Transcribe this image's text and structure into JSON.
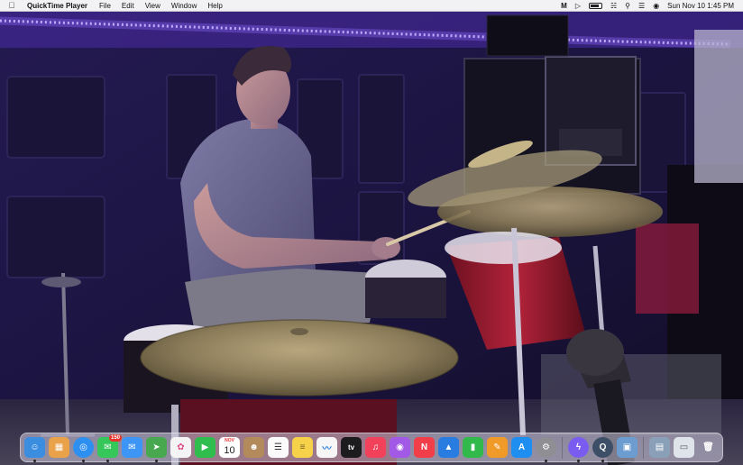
{
  "menubar": {
    "app_name": "QuickTime Player",
    "menus": [
      "File",
      "Edit",
      "View",
      "Window",
      "Help"
    ],
    "clock": "Sun Nov 10  1:45 PM",
    "status_icons": [
      "malwarebytes-icon",
      "play-icon",
      "battery-icon",
      "wifi-icon",
      "search-icon",
      "control-center-icon",
      "siri-icon"
    ]
  },
  "dock": {
    "apps": [
      {
        "name": "finder",
        "glyph": "☺",
        "color": "#3b8de0"
      },
      {
        "name": "launchpad",
        "glyph": "▦",
        "color": "#e9a14a"
      },
      {
        "name": "safari",
        "glyph": "◎",
        "color": "#2d8ff0"
      },
      {
        "name": "messages",
        "glyph": "✉",
        "color": "#35c759",
        "badge": "150"
      },
      {
        "name": "mail",
        "glyph": "✉",
        "color": "#3d95f5"
      },
      {
        "name": "maps",
        "glyph": "➤",
        "color": "#48a850"
      },
      {
        "name": "photos",
        "glyph": "✿",
        "color": "#f4f4f4"
      },
      {
        "name": "facetime",
        "glyph": "▶",
        "color": "#2fbe4e"
      },
      {
        "name": "calendar",
        "month": "NOV",
        "day": "10",
        "color": "#ffffff"
      },
      {
        "name": "contacts",
        "glyph": "☻",
        "color": "#b28a5c"
      },
      {
        "name": "reminders",
        "glyph": "☰",
        "color": "#fafafa"
      },
      {
        "name": "notes",
        "glyph": "≡",
        "color": "#f5d24a"
      },
      {
        "name": "freeform",
        "glyph": "〰",
        "color": "#f6f6f6"
      },
      {
        "name": "tv",
        "glyph": "tv",
        "color": "#1c1c1e"
      },
      {
        "name": "music",
        "glyph": "♫",
        "color": "#f2415a"
      },
      {
        "name": "podcasts",
        "glyph": "◉",
        "color": "#a259e6"
      },
      {
        "name": "news",
        "glyph": "N",
        "color": "#f13e48"
      },
      {
        "name": "keynote",
        "glyph": "▲",
        "color": "#2a7de0"
      },
      {
        "name": "numbers",
        "glyph": "▮",
        "color": "#31b94c"
      },
      {
        "name": "pages",
        "glyph": "✎",
        "color": "#f09a2a"
      },
      {
        "name": "app-store",
        "glyph": "A",
        "color": "#1f8ef1"
      },
      {
        "name": "system-settings",
        "glyph": "⚙",
        "color": "#8e8e93"
      },
      {
        "name": "messenger",
        "glyph": "ϟ",
        "color": "#7b5cf0"
      },
      {
        "name": "quicktime",
        "glyph": "Q",
        "color": "#3d4f66"
      },
      {
        "name": "preview",
        "glyph": "▣",
        "color": "#6c9cd0"
      }
    ],
    "extras": [
      {
        "name": "downloads-stack",
        "glyph": "▤",
        "color": "#8aa0b8"
      },
      {
        "name": "documents-stack",
        "glyph": "▭",
        "color": "#dfe4ea"
      },
      {
        "name": "trash",
        "glyph": "🗑",
        "color": "#c7c9cc"
      }
    ]
  }
}
